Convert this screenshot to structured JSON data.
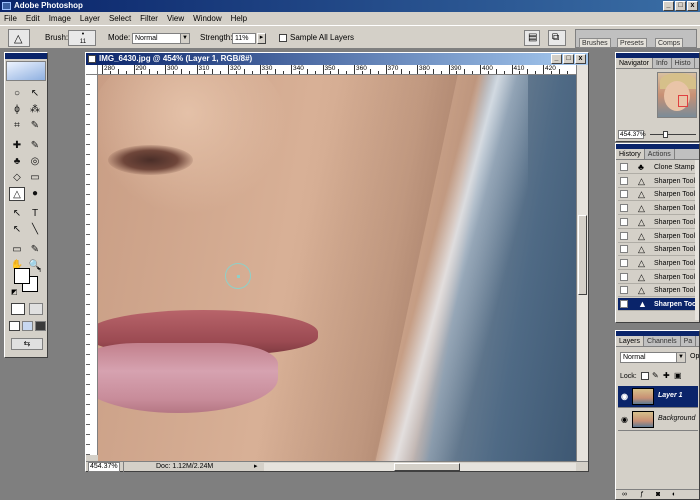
{
  "app": {
    "title": "Adobe Photoshop",
    "win_min": "_",
    "win_max": "□",
    "win_close": "x"
  },
  "menu": [
    "File",
    "Edit",
    "Image",
    "Layer",
    "Select",
    "Filter",
    "View",
    "Window",
    "Help"
  ],
  "options": {
    "brush_label": "Brush:",
    "brush_size": "11",
    "mode_label": "Mode:",
    "mode_value": "Normal",
    "strength_label": "Strength:",
    "strength_value": "11%",
    "sample_all_layers": "Sample All Layers",
    "well_tabs": [
      "Brushes",
      "Presets",
      "Comps"
    ]
  },
  "document": {
    "title": "IMG_6430.jpg @ 454% (Layer 1, RGB/8#)",
    "ruler_ticks": [
      "280",
      "290",
      "300",
      "310",
      "320",
      "330",
      "340",
      "350",
      "360",
      "370",
      "380",
      "390",
      "400",
      "410",
      "420"
    ],
    "status_zoom": "454.37%",
    "status_doc": "Doc: 1.12M/2.24M"
  },
  "navigator": {
    "tabs": [
      "Navigator",
      "Info",
      "Histo"
    ],
    "zoom": "454.37%"
  },
  "history": {
    "tabs": [
      "History",
      "Actions"
    ],
    "items": [
      {
        "label": "Clone Stamp",
        "icon": "clone-stamp-icon",
        "glyph": "♣"
      },
      {
        "label": "Sharpen Tool",
        "icon": "sharpen-icon",
        "glyph": "△"
      },
      {
        "label": "Sharpen Tool",
        "icon": "sharpen-icon",
        "glyph": "△"
      },
      {
        "label": "Sharpen Tool",
        "icon": "sharpen-icon",
        "glyph": "△"
      },
      {
        "label": "Sharpen Tool",
        "icon": "sharpen-icon",
        "glyph": "△"
      },
      {
        "label": "Sharpen Tool",
        "icon": "sharpen-icon",
        "glyph": "△"
      },
      {
        "label": "Sharpen Tool",
        "icon": "sharpen-icon",
        "glyph": "△"
      },
      {
        "label": "Sharpen Tool",
        "icon": "sharpen-icon",
        "glyph": "△"
      },
      {
        "label": "Sharpen Tool",
        "icon": "sharpen-icon",
        "glyph": "△"
      },
      {
        "label": "Sharpen Tool",
        "icon": "sharpen-icon",
        "glyph": "△"
      },
      {
        "label": "Sharpen Tool",
        "icon": "sharpen-icon",
        "glyph": "▲"
      }
    ]
  },
  "layers": {
    "tabs": [
      "Layers",
      "Channels",
      "Pa"
    ],
    "blend_mode": "Normal",
    "opacity_label": "Op",
    "lock_label": "Lock:",
    "items": [
      "Layer 1",
      "Background"
    ]
  },
  "toolbox": {
    "tools": [
      "○",
      "↖",
      "ϕ",
      "⁂",
      "⌗",
      "✎",
      "✚",
      "✎",
      "♣",
      "◎",
      "◇",
      "▭",
      "△",
      "●",
      "↖",
      "T",
      "↖",
      "╲",
      "▭",
      "✎",
      "✋",
      "🔍"
    ]
  }
}
